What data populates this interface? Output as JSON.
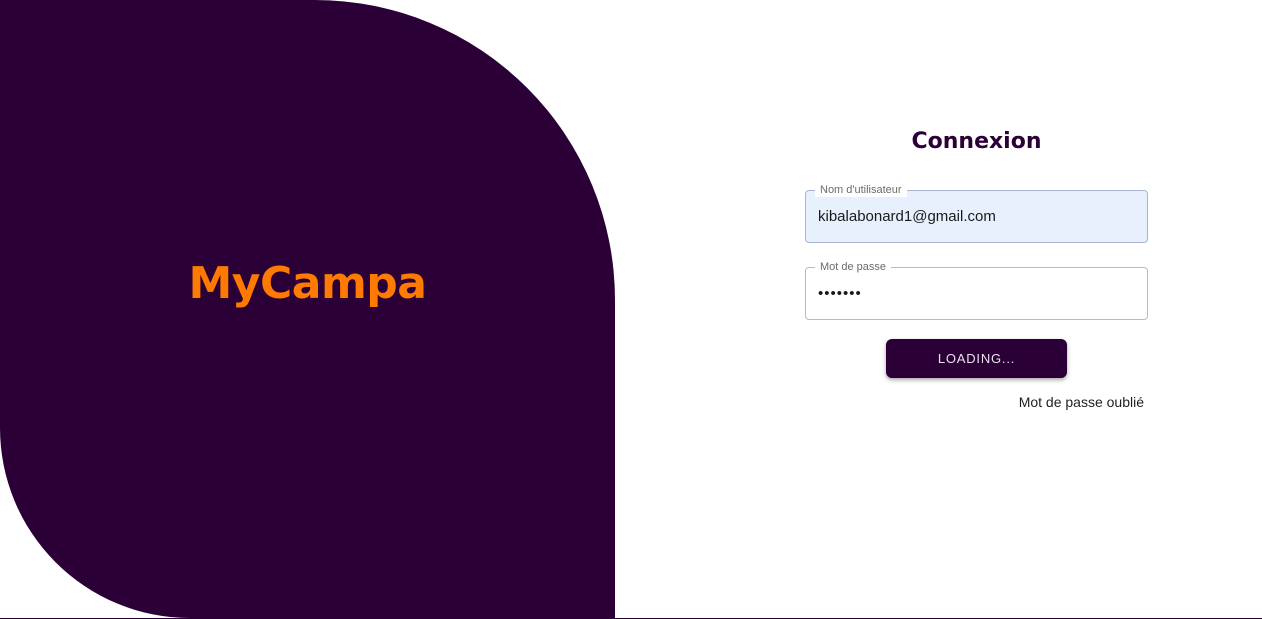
{
  "brand": {
    "logo_text": "MyCampa",
    "logo_color": "#ff7a00",
    "panel_color": "#2a0036"
  },
  "login": {
    "title": "Connexion",
    "username": {
      "label": "Nom d'utilisateur",
      "value": "kibalabonard1@gmail.com"
    },
    "password": {
      "label": "Mot de passe",
      "value": "•••••••"
    },
    "submit_label": "LOADING...",
    "forgot_password_label": "Mot de passe oublié"
  }
}
